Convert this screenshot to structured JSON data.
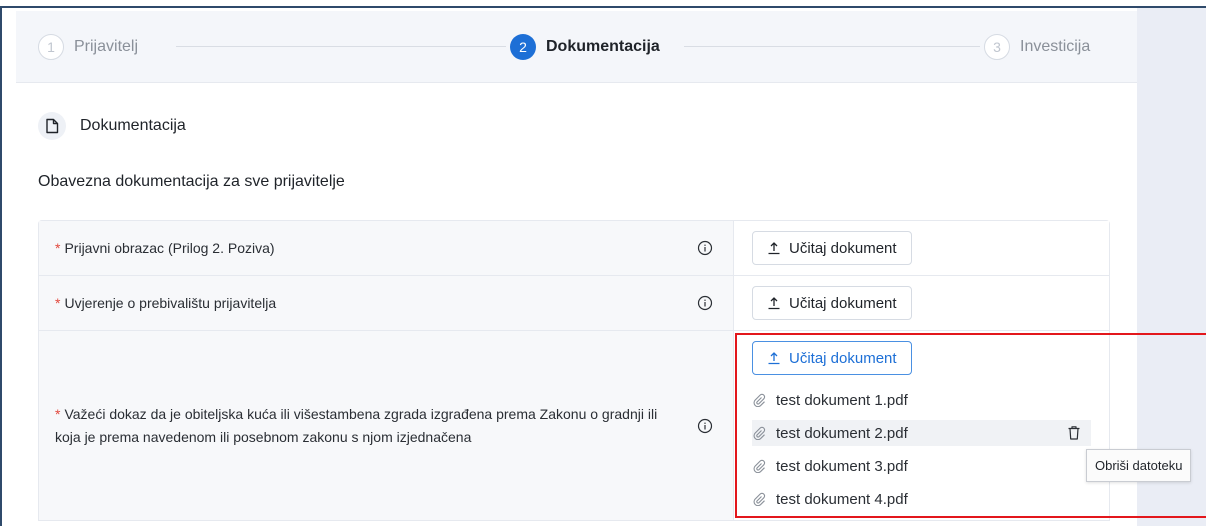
{
  "top_clip_text": "Investicija",
  "stepper": {
    "steps": [
      {
        "number": "1",
        "label": "Prijavitelj",
        "state": "inactive"
      },
      {
        "number": "2",
        "label": "Dokumentacija",
        "state": "active"
      },
      {
        "number": "3",
        "label": "Investicija",
        "state": "inactive"
      }
    ]
  },
  "section": {
    "title": "Dokumentacija",
    "icon": "document-icon"
  },
  "subtitle": "Obavezna dokumentacija za sve prijavitelje",
  "upload_label": "Učitaj dokument",
  "rows": [
    {
      "required": "*",
      "label": "Prijavni obrazac (Prilog 2. Poziva)"
    },
    {
      "required": "*",
      "label": "Uvjerenje o prebivalištu prijavitelja"
    },
    {
      "required": "*",
      "label": "Važeći dokaz da je obiteljska kuća ili višestambena zgrada izgrađena prema Zakonu o gradnji ili koja je prema navedenom ili posebnom zakonu s njom izjednačena"
    }
  ],
  "files": [
    "test dokument 1.pdf",
    "test dokument 2.pdf",
    "test dokument 3.pdf",
    "test dokument 4.pdf"
  ],
  "tooltip": "Obriši datoteku",
  "colors": {
    "accent": "#1d6fd6",
    "required": "#e2483d",
    "highlight_box": "#e3171c",
    "right_panel": "#eaedf5"
  }
}
